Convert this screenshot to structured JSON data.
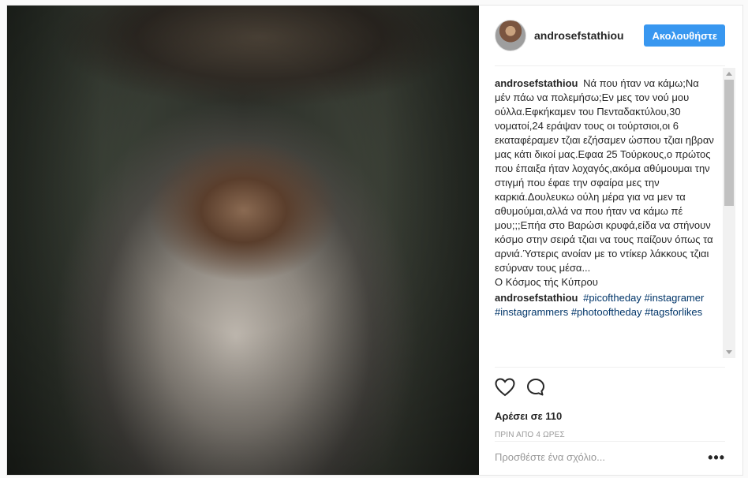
{
  "post": {
    "image_alt": "Portrait of an elderly bearded man with a knit headband, eyes closed",
    "author": "androsefstathiou",
    "follow_label": "Ακολουθήστε"
  },
  "comments": [
    {
      "user": "androsefstathiou",
      "text": "Νά που ήταν να κάμω;Να μέν πάω να πολεμήσω;Εν μες τον νού μου ούλλα.Εφκήκαμεν του Πενταδακτύλου,30 νοματοί,24 εράψαν τους οι τούρτσιοι,οι 6 εκαταφέραμεν τζιαι εζήσαμεν ώσπου τζιαι ηβραν μας κάτι δικοί μας.Εφαα 25 Τούρκους,ο πρώτος που έπαιξα ήταν λοχαγός,ακόμα αθύμουμαι την στιγμή που έφαε την σφαίρα μες την καρκιά.Δουλευκω ούλη μέρα για να μεν τα αθυμούμαι,αλλά να που ήταν να κάμω πέ μου;;;Επήα στο Βαρώσι κρυφά,είδα να στήνουν κόσμο στην σειρά τζιαι να τους παίζουν όπως τα αρνιά.Ύστερις ανοίαν με το ντίκερ λάκκους τζιαι εσύρναν τους μέσα...",
      "signature": "Ο Κόσμος τής Κύπρου"
    },
    {
      "user": "androsefstathiou",
      "tags": [
        "#picoftheday",
        "#instagramer",
        "#instagrammers",
        "#photooftheday",
        "#tagsforlikes"
      ]
    }
  ],
  "actions": {
    "like_icon": "heart-icon",
    "comment_icon": "speech-bubble-icon",
    "likes_text": "Αρέσει σε 110",
    "time_text": "ΠΡΙΝ ΑΠΟ 4 ΩΡΕΣ"
  },
  "add_comment": {
    "placeholder": "Προσθέστε ένα σχόλιο...",
    "more_label": "•••"
  }
}
